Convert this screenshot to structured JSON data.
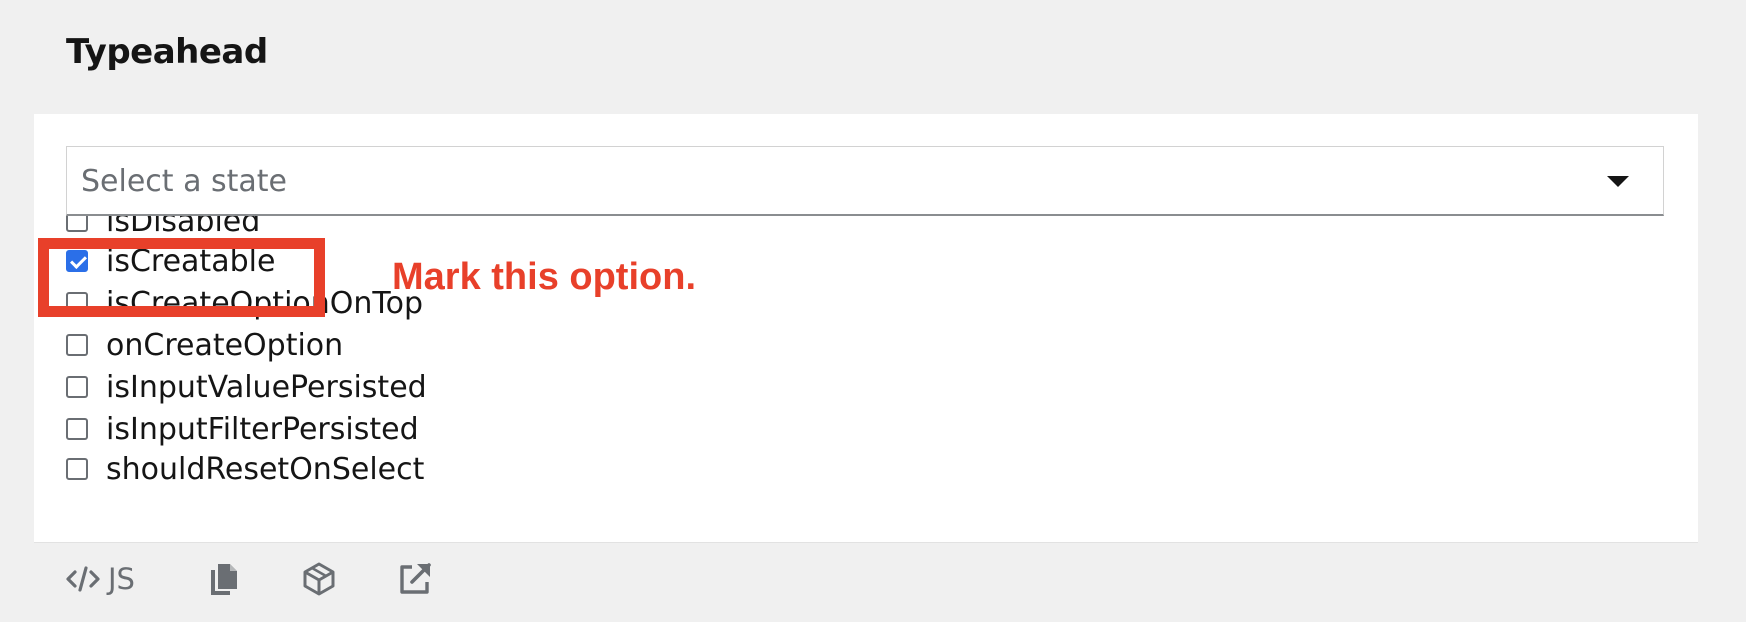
{
  "section": {
    "title": "Typeahead"
  },
  "select": {
    "placeholder": "Select a state"
  },
  "options": [
    {
      "label": "isDisabled",
      "checked": false
    },
    {
      "label": "isCreatable",
      "checked": true
    },
    {
      "label": "isCreateOptionOnTop",
      "checked": false
    },
    {
      "label": "onCreateOption",
      "checked": false
    },
    {
      "label": "isInputValuePersisted",
      "checked": false
    },
    {
      "label": "isInputFilterPersisted",
      "checked": false
    },
    {
      "label": "shouldResetOnSelect",
      "checked": false
    }
  ],
  "annotation": {
    "text": "Mark this option.",
    "color": "#e8402a"
  },
  "toolbar": {
    "js_label": "JS",
    "icons": [
      "code-icon",
      "copy-icon",
      "codesandbox-icon",
      "external-link-icon"
    ]
  },
  "colors": {
    "checkbox_checked": "#2b6fe8",
    "annotation": "#e8402a"
  }
}
